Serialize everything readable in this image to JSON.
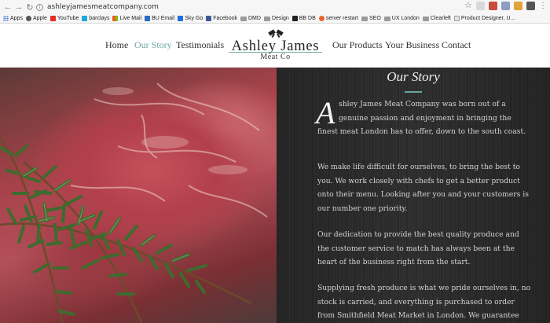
{
  "browser": {
    "url": "ashleyjamesmeatcompany.com",
    "bookmarks": [
      {
        "label": "Apps",
        "icon": "apps-grid-icon"
      },
      {
        "label": "Apple",
        "icon": "apple-icon"
      },
      {
        "label": "YouTube",
        "icon": "youtube-icon"
      },
      {
        "label": "barclays",
        "icon": "barclays-icon"
      },
      {
        "label": "Live Mail",
        "icon": "windows-icon"
      },
      {
        "label": "BU Email",
        "icon": "bu-icon"
      },
      {
        "label": "Sky Go",
        "icon": "sky-icon"
      },
      {
        "label": "Facebook",
        "icon": "facebook-icon"
      },
      {
        "label": "DMD",
        "icon": "folder-icon"
      },
      {
        "label": "Design",
        "icon": "folder-icon"
      },
      {
        "label": "BB DB",
        "icon": "bb-icon"
      },
      {
        "label": "server restart",
        "icon": "server-icon"
      },
      {
        "label": "SEO",
        "icon": "folder-icon"
      },
      {
        "label": "UX London",
        "icon": "folder-icon"
      },
      {
        "label": "Clearleft",
        "icon": "folder-icon"
      },
      {
        "label": "Product Designer, U...",
        "icon": "page-icon"
      }
    ]
  },
  "nav": {
    "home": "Home",
    "our_story": "Our Story",
    "testimonials": "Testimonials",
    "our_products": "Our Products",
    "your_business": "Your Business",
    "contact": "Contact"
  },
  "logo": {
    "title": "Ashley James",
    "subtitle": "Meat Co"
  },
  "story": {
    "title": "Our Story",
    "dropcap": "A",
    "p1": [
      "shley James Meat Company was born out of a",
      "genuine passion and enjoyment in bringing the",
      "finest meat London has to offer, down to the south coast."
    ],
    "p2": [
      "We make life difficult for ourselves, to bring the best to",
      "you. We work closely with chefs to get a better product",
      "onto their menu. Looking after you and your customers is",
      "our number one priority."
    ],
    "p3": [
      "Our dedication to provide the best quality produce and",
      "the customer service to match has always been at the",
      "heart of the business right from the start."
    ],
    "p4": [
      "Supplying fresh produce is what we pride ourselves in, no",
      "stock is carried, and everything is purchased to order",
      "from Smithfield Meat Market in London. We guarantee"
    ]
  },
  "colors": {
    "accent": "#6fa8a0",
    "panel": "#2a2a2a"
  }
}
